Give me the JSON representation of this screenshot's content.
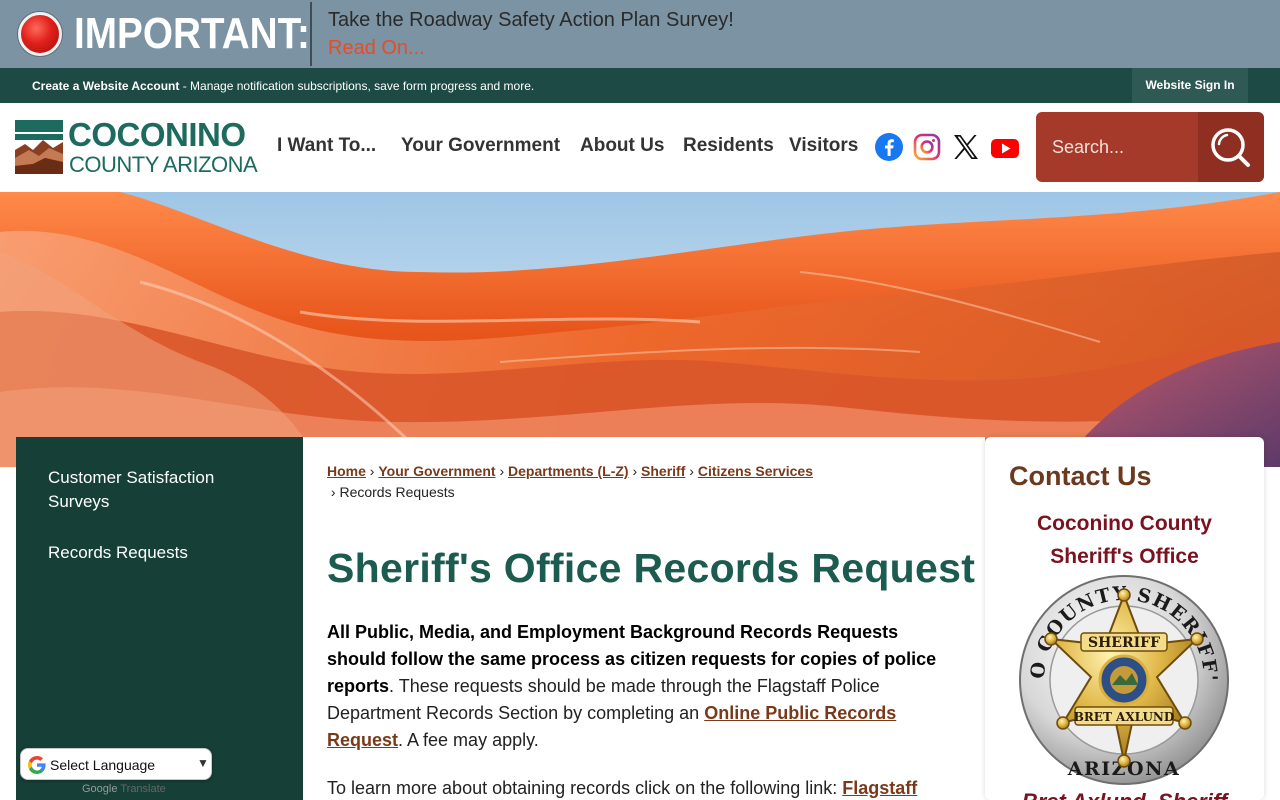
{
  "alert": {
    "label": "IMPORTANT:",
    "message": "Take the Roadway Safety Action Plan Survey!",
    "link": "Read On..."
  },
  "account_bar": {
    "link": "Create a Website Account",
    "text": " - Manage notification subscriptions, save form progress and more.",
    "sign_in": "Website Sign In"
  },
  "header": {
    "logo_line1": "COCONINO",
    "logo_line2": "COUNTY ARIZONA",
    "nav": [
      "I Want To...",
      "Your Government",
      "About Us",
      "Residents",
      "Visitors"
    ],
    "social": [
      "facebook-icon",
      "instagram-icon",
      "x-icon",
      "youtube-icon"
    ],
    "search_placeholder": "Search..."
  },
  "sidebar": {
    "items": [
      "Customer Satisfaction Surveys",
      "Records Requests"
    ]
  },
  "breadcrumb": {
    "links": [
      "Home",
      "Your Government",
      "Departments (L-Z)",
      "Sheriff",
      "Citizens Services"
    ],
    "current": "Records Requests",
    "separator": "›"
  },
  "main": {
    "title": "Sheriff's Office Records Request",
    "para1_bold": "All Public, Media, and Employment Background Records Requests should follow the same process as citizen requests for copies of police reports",
    "para1_text": ".  These requests should be made through the Flagstaff Police Department Records Section by completing an ",
    "para1_link": "Online Public Records Request",
    "para1_end": ".  A fee may apply.",
    "para2_text": "To learn more about obtaining records click on the following link: ",
    "para2_link": "Flagstaff"
  },
  "contact": {
    "heading": "Contact Us",
    "org_line1": "Coconino County",
    "org_line2": "Sheriff's Office",
    "badge_top": "COCONINO COUNTY SHERIFF'S OFFICE",
    "badge_center": "SHERIFF",
    "badge_name": "BRET AXLUND",
    "badge_bottom": "ARIZONA",
    "name": "Bret Axlund, Sheriff"
  },
  "translate": {
    "label": "Select Language",
    "powered_by": "Google",
    "powered_text": "Translate"
  },
  "colors": {
    "alert_bg": "#7b93a3",
    "dark_green": "#1d4a44",
    "sidebar": "#153f37",
    "brand_teal": "#1c6b5e",
    "search": "#a53a2a",
    "alert_link": "#e74b27",
    "sheriff_red": "#7a1220"
  }
}
